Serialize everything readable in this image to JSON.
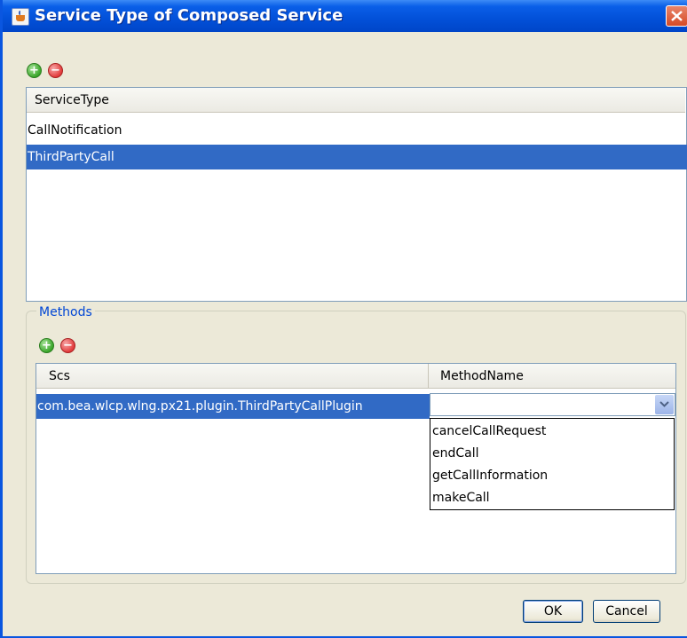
{
  "window": {
    "title": "Service Type of Composed Service"
  },
  "service_types": {
    "column_header": "ServiceType",
    "rows": [
      {
        "label": "CallNotification",
        "selected": false
      },
      {
        "label": "ThirdPartyCall",
        "selected": true
      }
    ]
  },
  "methods": {
    "group_title": "Methods",
    "columns": [
      "Scs",
      "MethodName"
    ],
    "rows": [
      {
        "scs": "com.bea.wlcp.wlng.px21.plugin.ThirdPartyCallPlugin",
        "method_name": ""
      }
    ],
    "method_options": [
      "cancelCallRequest",
      "endCall",
      "getCallInformation",
      "makeCall"
    ]
  },
  "buttons": {
    "ok": "OK",
    "cancel": "Cancel"
  },
  "icons": {
    "title": "java-cup-icon",
    "close": "close-icon",
    "add": "plus-icon",
    "remove": "minus-icon",
    "dropdown": "chevron-down-icon"
  },
  "colors": {
    "titlebar": "#0a5fe8",
    "selection": "#316ac5",
    "group_title": "#0046d5",
    "dialog_bg": "#ece9d8"
  }
}
